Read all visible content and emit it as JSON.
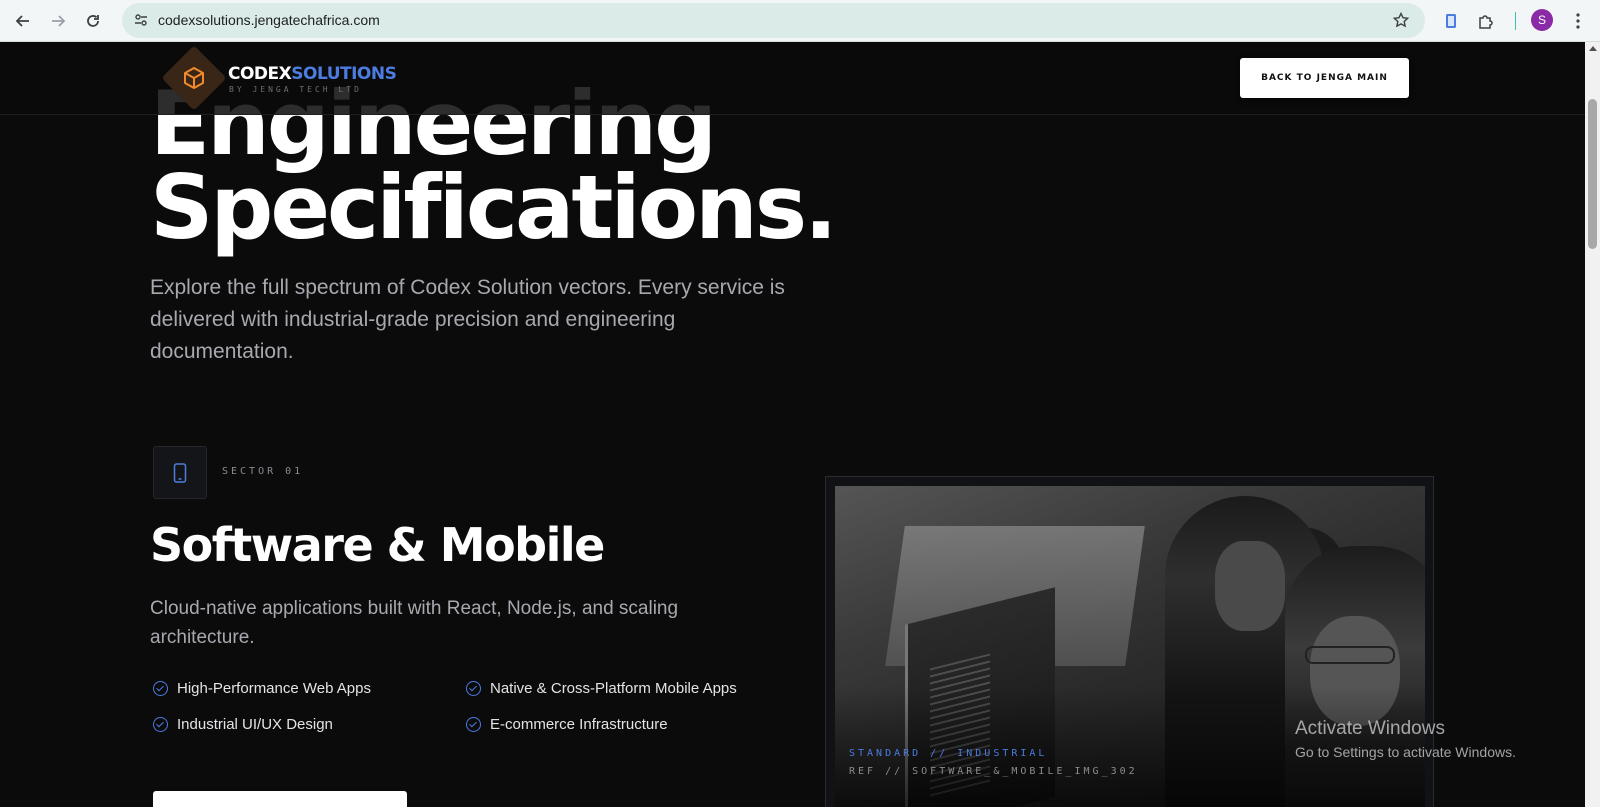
{
  "browser": {
    "url": "codexsolutions.jengatechafrica.com",
    "profile_initial": "S"
  },
  "header": {
    "logo_primary": "CODEX",
    "logo_accent": "SOLUTIONS",
    "logo_tagline": "BY JENGA TECH LTD",
    "back_button": "BACK TO JENGA MAIN"
  },
  "hero": {
    "title_line1": "Engineering",
    "title_line2": "Specifications.",
    "subtitle": "Explore the full spectrum of Codex Solution vectors. Every service is delivered with industrial-grade precision and engineering documentation."
  },
  "sector": {
    "label": "SECTOR 01",
    "title": "Software & Mobile",
    "description": "Cloud-native applications built with React, Node.js, and scaling architecture.",
    "features": [
      "High-Performance Web Apps",
      "Native & Cross-Platform Mobile Apps",
      "Industrial UI/UX Design",
      "E-commerce Infrastructure"
    ],
    "image_caption_1": "STANDARD // INDUSTRIAL",
    "image_caption_2": "REF // SOFTWARE_&_MOBILE_IMG_302"
  },
  "os_watermark": {
    "line1": "Activate Windows",
    "line2": "Go to Settings to activate Windows."
  },
  "colors": {
    "accent_blue": "#4c7ce0",
    "logo_orange": "#f08a2a",
    "page_bg": "#0b0b0c"
  }
}
